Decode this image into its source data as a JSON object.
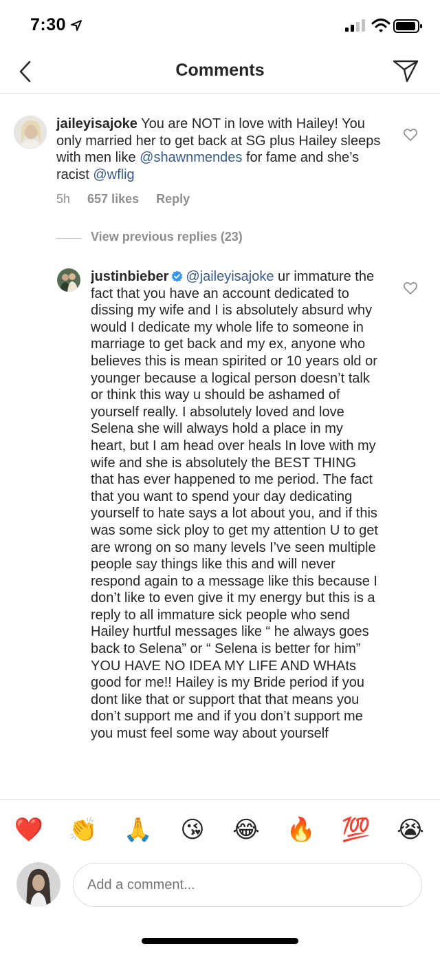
{
  "status_bar": {
    "time": "7:30"
  },
  "header": {
    "title": "Comments"
  },
  "comment": {
    "username": "jaileyisajoke",
    "text_parts": {
      "t1": "You are NOT in love with Hailey! You only married her to get back at SG plus Hailey sleeps with men like ",
      "m1": "@shawnmendes",
      "t2": " for fame and she’s racist ",
      "m2": "@wflig"
    },
    "time": "5h",
    "likes": "657 likes",
    "reply_label": "Reply"
  },
  "view_previous": "View previous replies (23)",
  "reply": {
    "username": "justinbieber",
    "mention": "@jaileyisajoke",
    "body": " ur immature the fact that you have an account dedicated to dissing my wife and I is absolutely absurd why would I dedicate my whole life to someone in marriage to get back and my ex, anyone who believes this is mean spirited or 10 years old or younger because a logical person doesn’t talk or think this way u should be ashamed of yourself really.  I absolutely loved and love Selena she will always hold a place in my heart, but I am head over heals In love with my wife and she is absolutely the BEST THING that has ever happened to me period. The fact that you want to spend your day dedicating yourself to hate says a lot about you, and if this was some sick ploy to get my attention U to get are wrong on so many levels I’ve seen multiple people say things like this and will never respond again to a message like this because I don’t like to even give it my energy but this is a reply to all immature sick people who send Hailey hurtful messages like “ he always goes back to Selena” or “ Selena is better for him” YOU HAVE NO IDEA MY LIFE AND WHAts good for me!! Hailey is my Bride period if you dont like that or support that that means you don’t support me and if you don’t support me you must feel some way about yourself"
  },
  "emojis": [
    "❤️",
    "👏",
    "🙏",
    "😘",
    "😂",
    "🔥",
    "💯",
    "😭"
  ],
  "comment_input": {
    "placeholder": "Add a comment..."
  },
  "colors": {
    "mention": "#3a5a80",
    "secondary_text": "#8e8e8e",
    "verified": "#3897f0"
  }
}
